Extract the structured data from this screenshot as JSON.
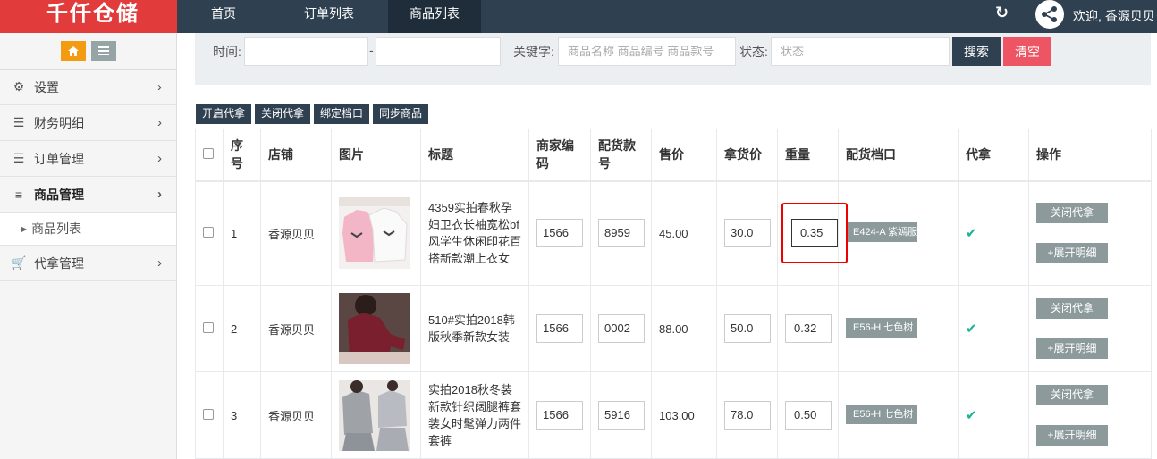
{
  "logo": {
    "text": "千仟仓储",
    "color": "#e23b3b"
  },
  "nav": {
    "items": [
      "首页",
      "订单列表",
      "商品列表"
    ],
    "active": "商品列表"
  },
  "header": {
    "welcome": "欢迎, 香源贝贝",
    "refresh_icon": "refresh-icon",
    "avatar_icon": "share-icon"
  },
  "sidebar": {
    "items": [
      {
        "label": "设置",
        "icon": "gears-icon"
      },
      {
        "label": "财务明细",
        "icon": "bars-icon"
      },
      {
        "label": "订单管理",
        "icon": "bars-icon"
      },
      {
        "label": "商品管理",
        "icon": "list-icon"
      },
      {
        "label": "代拿管理",
        "icon": "cart-icon"
      }
    ],
    "sub_item": "商品列表"
  },
  "search": {
    "time_label": "时间:",
    "separator": "-",
    "keyword_label": "关键字:",
    "keyword_placeholder": "商品名称 商品编号 商品款号",
    "status_label": "状态:",
    "status_placeholder": "状态",
    "search_button": "搜索",
    "clear_button": "清空"
  },
  "actions": [
    "开启代拿",
    "关闭代拿",
    "绑定档口",
    "同步商品"
  ],
  "table": {
    "headers": [
      "序号",
      "店铺",
      "图片",
      "标题",
      "商家编码",
      "配货款号",
      "售价",
      "拿货价",
      "重量",
      "配货档口",
      "代拿",
      "操作"
    ],
    "rows": [
      {
        "index": "1",
        "shop": "香源贝贝",
        "title": "4359实拍春秋孕妇卫衣长袖宽松bf风学生休闲印花百搭新款潮上衣女",
        "merchant_code": "1566",
        "style_no": "8959",
        "price": "45.00",
        "cost": "30.0",
        "weight": "0.35",
        "stall": "E424-A 紫嫣服",
        "op1": "关闭代拿",
        "op2": "+展开明细"
      },
      {
        "index": "2",
        "shop": "香源贝贝",
        "title": "510#实拍2018韩版秋季新款女装",
        "merchant_code": "1566",
        "style_no": "0002",
        "price": "88.00",
        "cost": "50.0",
        "weight": "0.32",
        "stall": "E56-H 七色树",
        "op1": "关闭代拿",
        "op2": "+展开明细"
      },
      {
        "index": "3",
        "shop": "香源贝贝",
        "title": "实拍2018秋冬装新款针织阔腿裤套装女时髦弹力两件套裤",
        "merchant_code": "1566",
        "style_no": "5916",
        "price": "103.00",
        "cost": "78.0",
        "weight": "0.50",
        "stall": "E56-H 七色树",
        "op1": "关闭代拿",
        "op2": "+展开明细"
      }
    ]
  },
  "colors": {
    "topbar": "#2f4050",
    "accent_red": "#ed5565",
    "check": "#1ab394",
    "gray_button": "#8c9a9c"
  }
}
